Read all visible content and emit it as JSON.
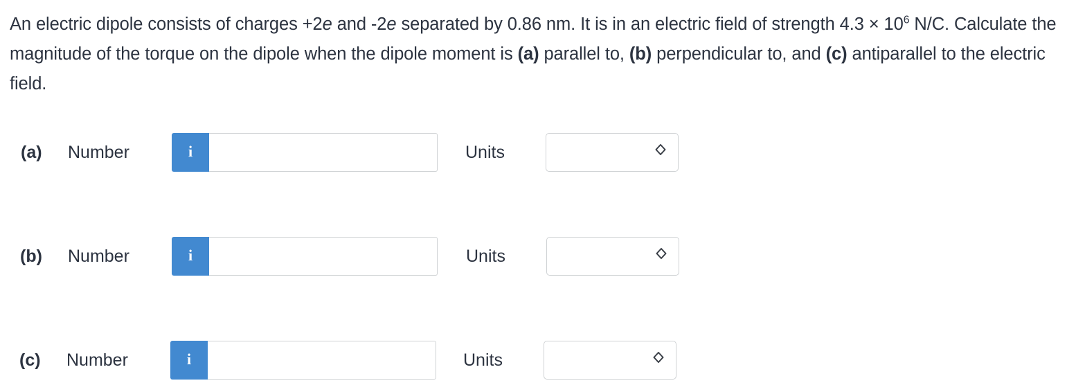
{
  "question": {
    "segment_1": "An electric dipole consists of charges +2",
    "italic_1": "e",
    "segment_2": " and -2",
    "italic_2": "e",
    "segment_3": " separated by 0.86 nm. It is in an electric field of strength 4.3 × 10",
    "exponent": "6",
    "segment_4": " N/C. Calculate the magnitude of the torque on the dipole when the dipole moment is ",
    "bold_a": "(a)",
    "segment_5": " parallel to, ",
    "bold_b": "(b)",
    "segment_6": " perpendicular to, and ",
    "bold_c": "(c)",
    "segment_7": " antiparallel to the electric field."
  },
  "rows": [
    {
      "part": "(a)",
      "number_label": "Number",
      "info_icon": "info-i-icon",
      "info_glyph": "i",
      "number_value": "",
      "number_placeholder": "",
      "units_label": "Units",
      "units_value": "",
      "units_options": [
        ""
      ],
      "chevron_icon": "chevron-up-down-icon"
    },
    {
      "part": "(b)",
      "number_label": "Number",
      "info_icon": "info-i-icon",
      "info_glyph": "i",
      "number_value": "",
      "number_placeholder": "",
      "units_label": "Units",
      "units_value": "",
      "units_options": [
        ""
      ],
      "chevron_icon": "chevron-up-down-icon"
    },
    {
      "part": "(c)",
      "number_label": "Number",
      "info_icon": "info-i-icon",
      "info_glyph": "i",
      "number_value": "",
      "number_placeholder": "",
      "units_label": "Units",
      "units_value": "",
      "units_options": [
        ""
      ],
      "chevron_icon": "chevron-up-down-icon"
    }
  ],
  "colors": {
    "info_button_blue": "#4289d0",
    "text": "#2c3340",
    "border": "#cfd2d4",
    "background": "#ffffff"
  }
}
